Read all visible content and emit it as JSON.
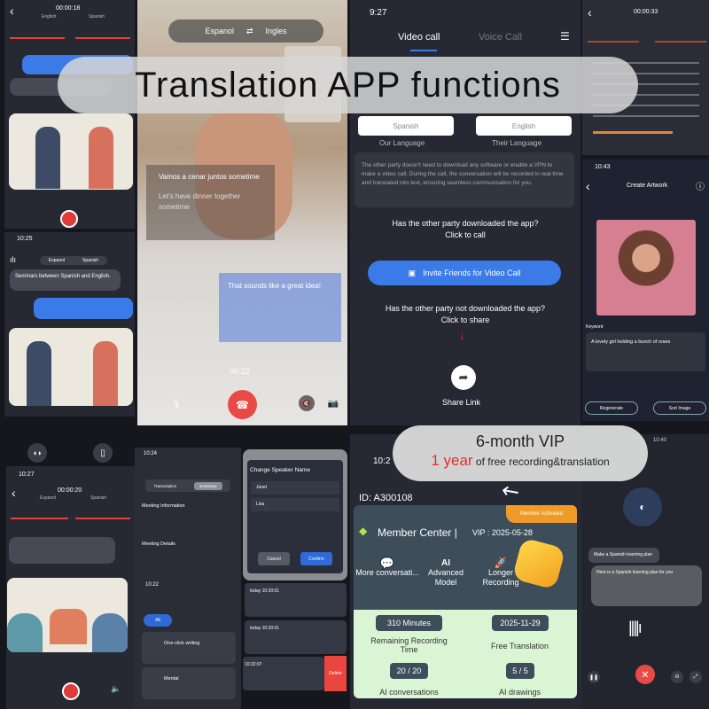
{
  "banner": {
    "title": "Translation APP functions"
  },
  "vip_callout": {
    "line1": "6-month VIP",
    "highlight": "1 year",
    "line2": " of free recording&translation",
    "highlight_color": "#e0302a"
  },
  "rec1": {
    "timer": "00:00:18",
    "lang_left": "English",
    "lang_right": "Spanish"
  },
  "rec2": {
    "time": "10:25",
    "message_en": "Seminars between Spanish and English.",
    "lang_left": "Espanol",
    "lang_right": "Spanish"
  },
  "video": {
    "lang_left": "Espanol",
    "lang_right": "Ingles",
    "sub1": "Vamos a cenar juntos sometime",
    "sub2": "Let's have dinner together sometime",
    "sub3": "That sounds like a great idea!",
    "timer": "00:22"
  },
  "call": {
    "time": "9:27",
    "tabs": [
      "Video call",
      "Voice Call"
    ],
    "our_lang": "Spanish",
    "their_lang": "English",
    "our_label": "Our Language",
    "their_label": "Their Language",
    "description": "The other party doesn't need to download any software or enable a VPN to make a video call. During the call, the conversation will be recorded in real time and translated into text, ensuring seamless communication for you.",
    "q1": "Has the other party downloaded the app?",
    "q1b": "Click to call",
    "invite": "Invite Friends for Video Call",
    "q2": "Has the other party not downloaded the app?",
    "q2b": "Click to share",
    "share": "Share Link",
    "accent": "#3b7be8"
  },
  "transcript": {
    "timer": "00:00:33"
  },
  "artwork": {
    "time": "10:43",
    "title": "Create Artwork",
    "keyword_label": "Keyword",
    "prompt": "A lovely girl holding a bunch of roses",
    "btn_left": "Regenerate",
    "btn_right": "Sort Image"
  },
  "rec3": {
    "time": "10:27",
    "timer": "00:00:20",
    "lang_left": "Espanol",
    "lang_right": "Spanish"
  },
  "meeting": {
    "time": "10:24",
    "tabs": [
      "Transcription",
      "Summary"
    ],
    "section1": "Meeting Information",
    "section2": "Meeting Details"
  },
  "speaker_dialog": {
    "title": "Change Speaker Name",
    "names": [
      "Jonel",
      "Lisa"
    ],
    "cancel": "Cancel",
    "confirm": "Confirm"
  },
  "ai_tools": {
    "time": "10:22",
    "items": [
      "One-click writing",
      "Mental"
    ],
    "all": "All"
  },
  "records": {
    "items": [
      "today 10:20:01",
      "today 10:20:01",
      "10:22:07"
    ],
    "delete": "Delete"
  },
  "member": {
    "time": "10:2",
    "id": "ID: A300108",
    "title": "Member Center |",
    "vip": "VIP : 2025-05-28",
    "badge": "Member Activated",
    "features": [
      "More conversati...",
      "Advanced Model",
      "Longer Recording"
    ],
    "stats": [
      {
        "value": "310 Minutes",
        "label": "Remaining Recording Time"
      },
      {
        "value": "2025-11-29",
        "label": "Free Translation"
      },
      {
        "value": "20 / 20",
        "label": "AI conversations"
      },
      {
        "value": "5 / 5",
        "label": "AI drawings"
      }
    ]
  },
  "ai_chat": {
    "time": "10:40",
    "prompt": "Make a Spanish learning plan",
    "reply": "Here is a Spanish learning plan for you"
  }
}
